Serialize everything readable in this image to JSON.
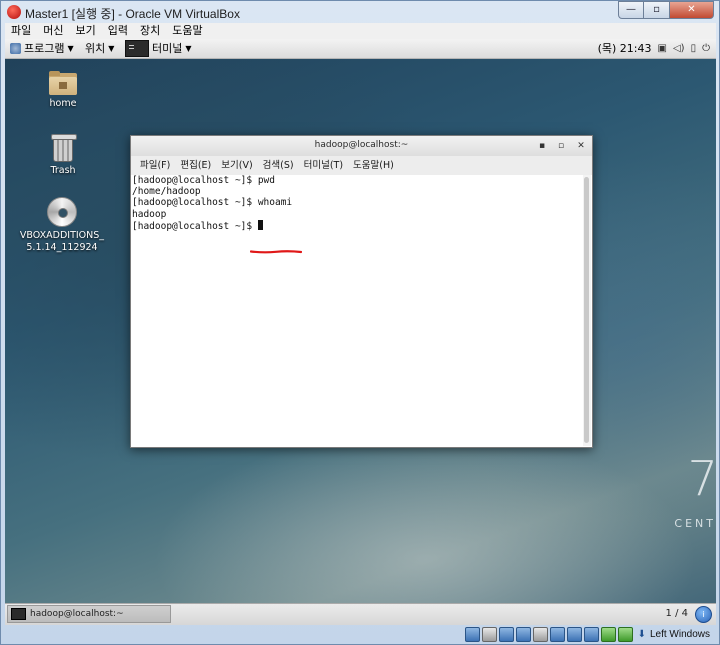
{
  "vbox": {
    "title": "Master1 [실행 중] - Oracle VM VirtualBox",
    "controls": {
      "minimize": "—",
      "maximize": "▫",
      "close": "✕"
    },
    "menu": [
      "파일",
      "머신",
      "보기",
      "입력",
      "장치",
      "도움말"
    ],
    "host_key": "Left Windows",
    "colors": {
      "frame": "#c4d5ea",
      "close_button": "#c14a32"
    }
  },
  "gnome": {
    "topbar": {
      "applications": "프로그램",
      "places": "위치",
      "terminal": "터미널",
      "clock": "(목) 21:43",
      "tray_icons": [
        "display-icon",
        "volume-icon",
        "battery-icon",
        "power-icon"
      ]
    },
    "desktop_icons": [
      {
        "label": "home",
        "icon": "home-folder-icon"
      },
      {
        "label": "Trash",
        "icon": "trash-icon"
      },
      {
        "label": "VBOXADDITIONS_ 5.1.14_112924",
        "icon": "cd-disc-icon"
      }
    ],
    "branding": {
      "version": "7",
      "text": "CENT"
    },
    "bottom_panel": {
      "task_label": "hadoop@localhost:~",
      "workspace": "1 / 4"
    }
  },
  "terminal": {
    "title": "hadoop@localhost:~",
    "controls": {
      "minimize": "▪",
      "maximize": "▫",
      "close": "✕"
    },
    "menu": [
      "파일(F)",
      "편집(E)",
      "보기(V)",
      "검색(S)",
      "터미널(T)",
      "도움말(H)"
    ],
    "lines": [
      {
        "prompt": "[hadoop@localhost ~]$",
        "text": " pwd"
      },
      {
        "prompt": "",
        "text": "/home/hadoop"
      },
      {
        "prompt": "[hadoop@localhost ~]$",
        "text": " whoami"
      },
      {
        "prompt": "",
        "text": "hadoop"
      },
      {
        "prompt": "[hadoop@localhost ~]$",
        "text": " "
      }
    ],
    "annotation_color": "#e01818"
  }
}
